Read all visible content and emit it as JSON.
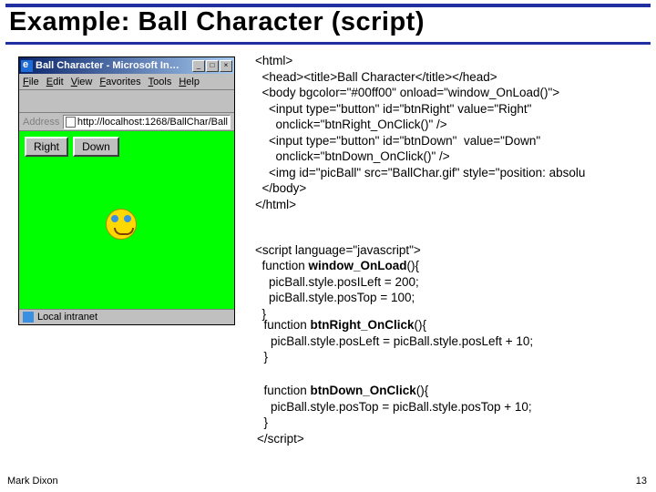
{
  "slide": {
    "title": "Example: Ball Character (script)",
    "author": "Mark Dixon",
    "page": "13"
  },
  "browser": {
    "title": "Ball Character - Microsoft In…",
    "menu": [
      "File",
      "Edit",
      "View",
      "Favorites",
      "Tools",
      "Help"
    ],
    "address_label": "Address",
    "url": "http://localhost:1268/BallChar/Ball",
    "buttons": {
      "right": "Right",
      "down": "Down"
    },
    "status_zone": "Local intranet"
  },
  "code": {
    "html_block": "<html>\n  <head><title>Ball Character</title></head>\n  <body bgcolor=\"#00ff00\" onload=\"window_OnLoad()\">\n    <input type=\"button\" id=\"btnRight\" value=\"Right\"\n      onclick=\"btnRight_OnClick()\" />\n    <input type=\"button\" id=\"btnDown\"  value=\"Down\"\n      onclick=\"btnDown_OnClick()\" />\n    <img id=\"picBall\" src=\"BallChar.gif\" style=\"position: absolu\n  </body>\n</html>",
    "script_open": "<script language=\"javascript\">",
    "fn_load_sig": "window_OnLoad",
    "fn_load_body": "    picBall.style.posILeft = 200;\n    picBall.style.posTop = 100;\n  }",
    "fn_right_sig": "btnRight_OnClick",
    "fn_right_body": "    picBall.style.posLeft = picBall.style.posLeft + 10;\n  }",
    "fn_down_sig": "btnDown_OnClick",
    "fn_down_body": "    picBall.style.posTop = picBall.style.posTop + 10;\n  }\n</script>"
  }
}
